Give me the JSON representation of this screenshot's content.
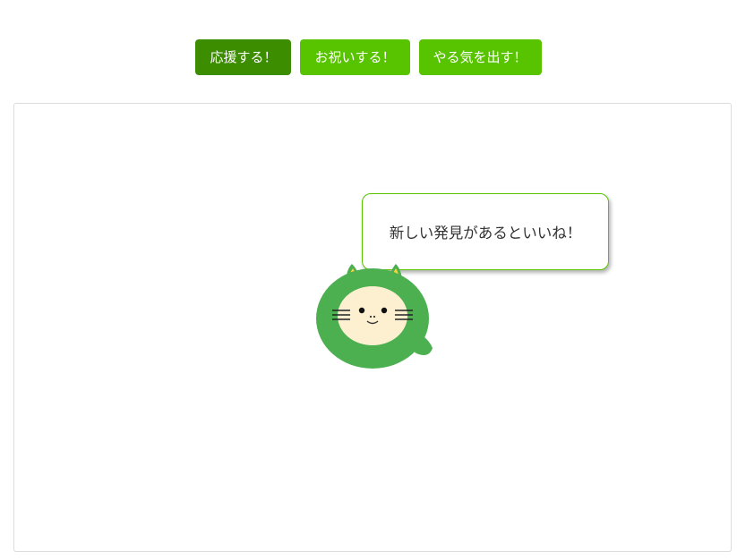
{
  "toolbar": {
    "buttons": [
      {
        "label": "応援する！",
        "active": true
      },
      {
        "label": "お祝いする！",
        "active": false
      },
      {
        "label": "やる気を出す！",
        "active": false
      }
    ]
  },
  "stage": {
    "message": "新しい発見があるといいね！"
  },
  "colors": {
    "button": "#58c400",
    "button_active": "#3c8d00",
    "bubble_border": "#58c400",
    "mascot_body": "#4caf50",
    "mascot_face": "#fdf0d0",
    "mascot_ear_inner": "#f5d33b"
  },
  "icons": {
    "mascot": "green-hooded-cat-mascot"
  }
}
